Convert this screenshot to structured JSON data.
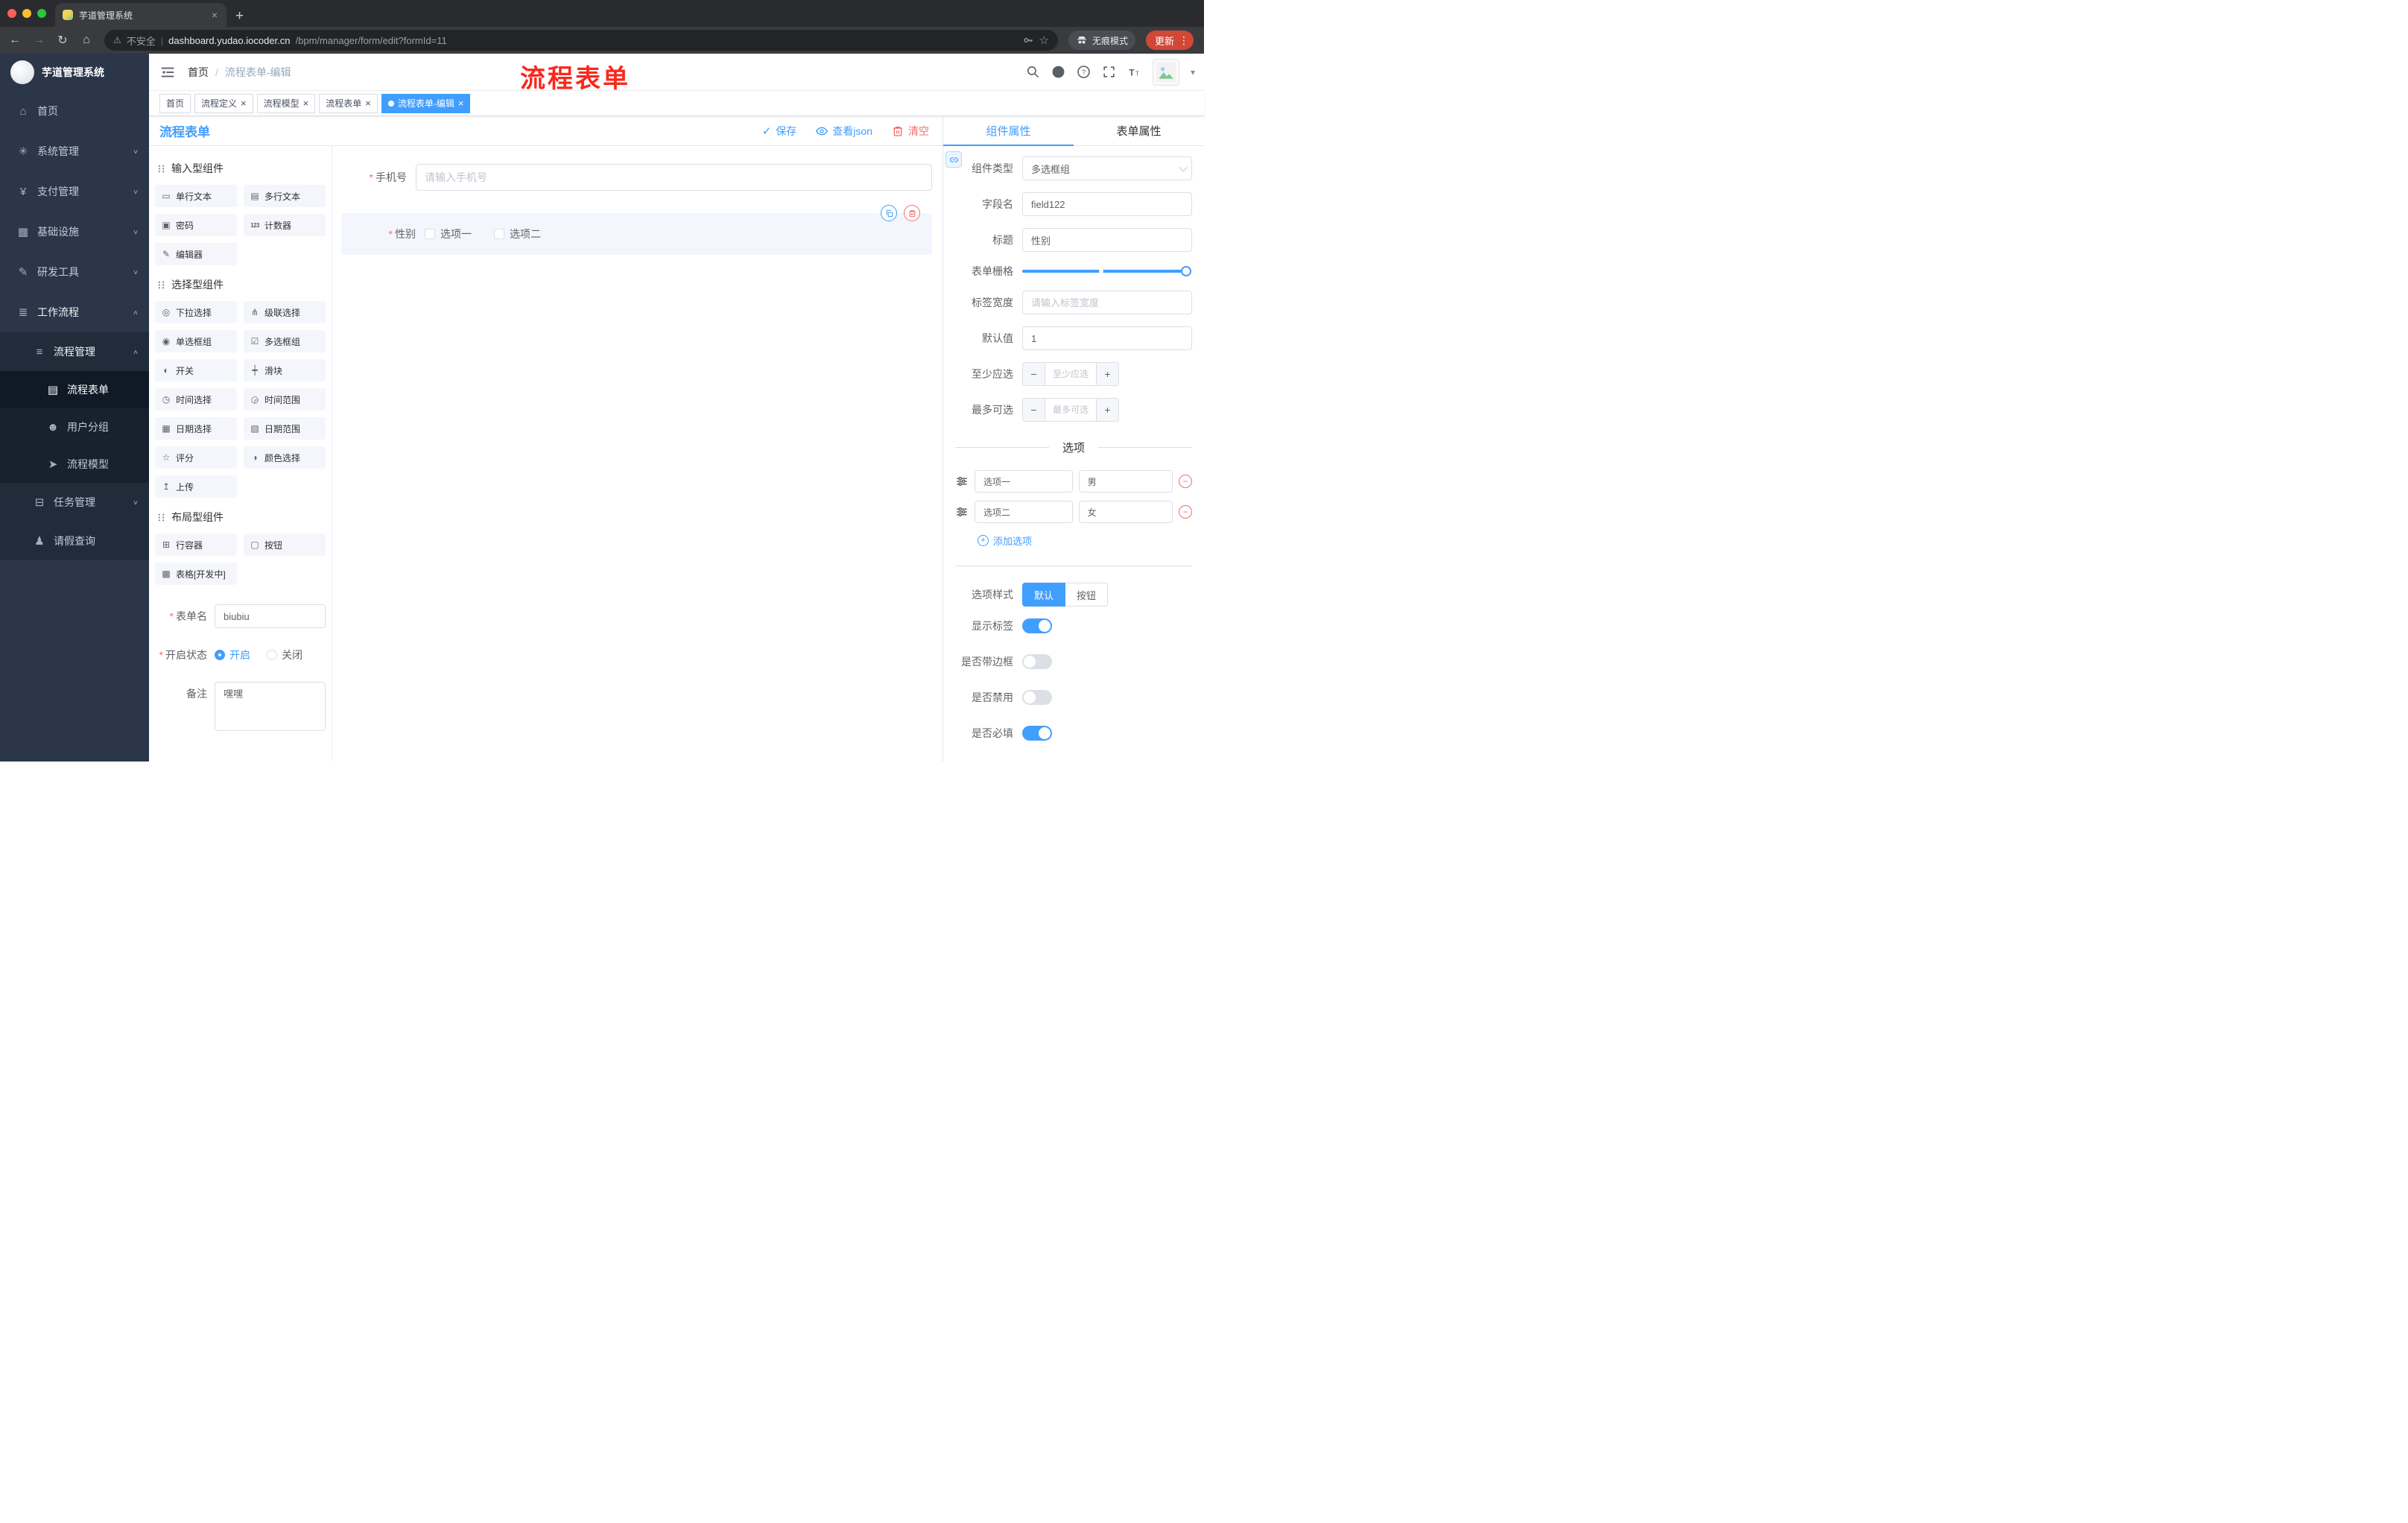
{
  "colors": {
    "accent_blue": "#409eff",
    "danger_red": "#f56c6c",
    "annotation_red": "#f8281d",
    "sidebar_bg": "#2b3648"
  },
  "browser": {
    "tab_title": "芋道管理系统",
    "security_label": "不安全",
    "url_sep": "|",
    "url_host": "dashboard.yudao.iocoder.cn",
    "url_path": "/bpm/manager/form/edit?formId=11",
    "incognito_label": "无痕模式",
    "update_label": "更新"
  },
  "annotation": {
    "text": "流程表单"
  },
  "sidebar": {
    "logo_title": "芋道管理系统",
    "menu": [
      {
        "label": "首页",
        "icon": "⌂",
        "chev": ""
      },
      {
        "label": "系统管理",
        "icon": "✳",
        "chev": "∨"
      },
      {
        "label": "支付管理",
        "icon": "¥",
        "chev": "∨"
      },
      {
        "label": "基础设施",
        "icon": "▦",
        "chev": "∨"
      },
      {
        "label": "研发工具",
        "icon": "✎",
        "chev": "∨"
      },
      {
        "label": "工作流程",
        "icon": "≣",
        "chev": "∧",
        "open": true
      },
      {
        "label": "流程管理",
        "icon": "≡",
        "chev": "∧",
        "is2": true,
        "open": true
      },
      {
        "label": "流程表单",
        "icon": "▤",
        "chev": "",
        "is3": true,
        "active": true
      },
      {
        "label": "用户分组",
        "icon": "☻",
        "chev": "",
        "is3": true
      },
      {
        "label": "流程模型",
        "icon": "➤",
        "chev": "",
        "is3": true
      },
      {
        "label": "任务管理",
        "icon": "⊟",
        "chev": "∨",
        "is2": true
      },
      {
        "label": "请假查询",
        "icon": "♟",
        "chev": "",
        "is2": true
      }
    ]
  },
  "header": {
    "breadcrumb_home": "首页",
    "breadcrumb_sep": "/",
    "breadcrumb_current": "流程表单-编辑"
  },
  "tags": [
    {
      "label": "首页",
      "close": ""
    },
    {
      "label": "流程定义",
      "close": "×"
    },
    {
      "label": "流程模型",
      "close": "×"
    },
    {
      "label": "流程表单",
      "close": "×"
    },
    {
      "label": "流程表单-编辑",
      "close": "×",
      "active": true
    }
  ],
  "editor": {
    "title": "流程表单",
    "save_label": "保存",
    "view_json_label": "查看json",
    "clear_label": "清空"
  },
  "palette": {
    "groups": [
      {
        "title": "输入型组件",
        "items": [
          {
            "icon": "▭",
            "label": "单行文本"
          },
          {
            "icon": "▤",
            "label": "多行文本"
          },
          {
            "icon": "▣",
            "label": "密码"
          },
          {
            "icon": "123",
            "label": "计数器",
            "small": true
          },
          {
            "icon": "✎",
            "label": "编辑器"
          }
        ]
      },
      {
        "title": "选择型组件",
        "items": [
          {
            "icon": "◎",
            "label": "下拉选择"
          },
          {
            "icon": "⋔",
            "label": "级联选择"
          },
          {
            "icon": "◉",
            "label": "单选框组"
          },
          {
            "icon": "☑",
            "label": "多选框组"
          },
          {
            "icon": "◐",
            "label": "开关"
          },
          {
            "icon": "┿",
            "label": "滑块"
          },
          {
            "icon": "◷",
            "label": "时间选择"
          },
          {
            "icon": "◶",
            "label": "时间范围"
          },
          {
            "icon": "▦",
            "label": "日期选择"
          },
          {
            "icon": "▧",
            "label": "日期范围"
          },
          {
            "icon": "☆",
            "label": "评分"
          },
          {
            "icon": "◑",
            "label": "颜色选择"
          },
          {
            "icon": "↥",
            "label": "上传"
          }
        ]
      },
      {
        "title": "布局型组件",
        "items": [
          {
            "icon": "⊞",
            "label": "行容器"
          },
          {
            "icon": "▢",
            "label": "按钮"
          },
          {
            "icon": "▩",
            "label": "表格[开发中]"
          }
        ]
      }
    ]
  },
  "form_settings": {
    "name_label": "表单名",
    "name_value": "biubiu",
    "status_label": "开启状态",
    "status_on": "开启",
    "status_off": "关闭",
    "remark_label": "备注",
    "remark_value": "嘿嘿"
  },
  "canvas": {
    "phone": {
      "label": "手机号",
      "placeholder": "请输入手机号"
    },
    "gender": {
      "label": "性别",
      "option1": "选项一",
      "option2": "选项二"
    }
  },
  "properties": {
    "tab_component": "组件属性",
    "tab_form": "表单属性",
    "component_type_label": "组件类型",
    "component_type_value": "多选框组",
    "field_name_label": "字段名",
    "field_name_value": "field122",
    "title_label": "标题",
    "title_value": "性别",
    "grid_label": "表单栅格",
    "label_width_label": "标签宽度",
    "label_width_placeholder": "请输入标签宽度",
    "default_label": "默认值",
    "default_value": "1",
    "min_label": "至少应选",
    "min_placeholder": "至少应选",
    "max_label": "最多可选",
    "max_placeholder": "最多可选",
    "options_title": "选项",
    "options": [
      {
        "name": "选项一",
        "value": "男"
      },
      {
        "name": "选项二",
        "value": "女"
      }
    ],
    "add_option_label": "添加选项",
    "option_style_label": "选项样式",
    "style_default": "默认",
    "style_button": "按钮",
    "show_label_label": "显示标签",
    "show_label_on": true,
    "border_label": "是否带边框",
    "border_on": false,
    "disabled_label": "是否禁用",
    "disabled_on": false,
    "required_label": "是否必填",
    "required_on": true
  }
}
